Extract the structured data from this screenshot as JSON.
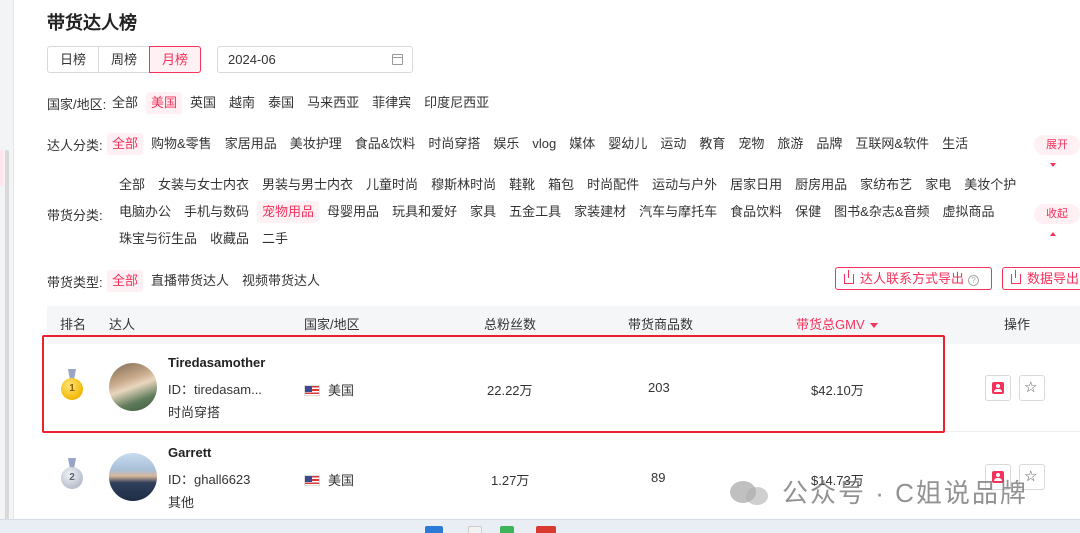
{
  "title": "带货达人榜",
  "period_tabs": [
    {
      "label": "日榜",
      "active": false
    },
    {
      "label": "周榜",
      "active": false
    },
    {
      "label": "月榜",
      "active": true
    }
  ],
  "date_value": "2024-06",
  "region": {
    "label": "国家/地区:",
    "options": [
      "全部",
      "美国",
      "英国",
      "越南",
      "泰国",
      "马来西亚",
      "菲律宾",
      "印度尼西亚"
    ],
    "active": "美国"
  },
  "influencer_category": {
    "label": "达人分类:",
    "options": [
      "全部",
      "购物&零售",
      "家居用品",
      "美妆护理",
      "食品&饮料",
      "时尚穿搭",
      "娱乐",
      "vlog",
      "媒体",
      "婴幼儿",
      "运动",
      "教育",
      "宠物",
      "旅游",
      "品牌",
      "互联网&软件",
      "生活"
    ],
    "active": "全部",
    "expand_label": "展开"
  },
  "product_category": {
    "label": "带货分类:",
    "lines": [
      [
        "全部",
        "女装与女士内衣",
        "男装与男士内衣",
        "儿童时尚",
        "穆斯林时尚",
        "鞋靴",
        "箱包",
        "时尚配件",
        "运动与户外",
        "居家日用",
        "厨房用品",
        "家纺布艺",
        "家电",
        "美妆个护"
      ],
      [
        "电脑办公",
        "手机与数码",
        "宠物用品",
        "母婴用品",
        "玩具和爱好",
        "家具",
        "五金工具",
        "家装建材",
        "汽车与摩托车",
        "食品饮料",
        "保健",
        "图书&杂志&音频",
        "虚拟商品"
      ],
      [
        "珠宝与衍生品",
        "收藏品",
        "二手"
      ]
    ],
    "active": "宠物用品",
    "collapse_label": "收起"
  },
  "selling_type": {
    "label": "带货类型:",
    "options": [
      "全部",
      "直播带货达人",
      "视频带货达人"
    ],
    "active": "全部"
  },
  "export_contact_label": "达人联系方式导出",
  "export_data_label": "数据导出",
  "table": {
    "headers": {
      "rank": "排名",
      "influencer": "达人",
      "region": "国家/地区",
      "followers": "总粉丝数",
      "products": "带货商品数",
      "gmv": "带货总GMV",
      "actions": "操作"
    },
    "rows": [
      {
        "rank": 1,
        "medal": "gold",
        "name": "Tiredasamother",
        "id": "ID：tiredasam...",
        "category": "时尚穿搭",
        "region": "美国",
        "followers": "22.22万",
        "products": "203",
        "gmv": "$42.10万"
      },
      {
        "rank": 2,
        "medal": "silver",
        "name": "Garrett",
        "id": "ID：ghall6623",
        "category": "其他",
        "region": "美国",
        "followers": "1.27万",
        "products": "89",
        "gmv": "$14.73万"
      }
    ]
  },
  "watermark": "公众号 · C姐说品牌",
  "colors": {
    "accent": "#f5325c",
    "highlight_box": "#e8232f"
  },
  "icons": [
    "calendar-icon",
    "export-icon",
    "help-icon",
    "sort-desc-icon",
    "gold-medal-icon",
    "silver-medal-icon",
    "us-flag-icon",
    "contact-card-icon",
    "star-icon",
    "chevron-down-icon",
    "chevron-up-icon"
  ]
}
